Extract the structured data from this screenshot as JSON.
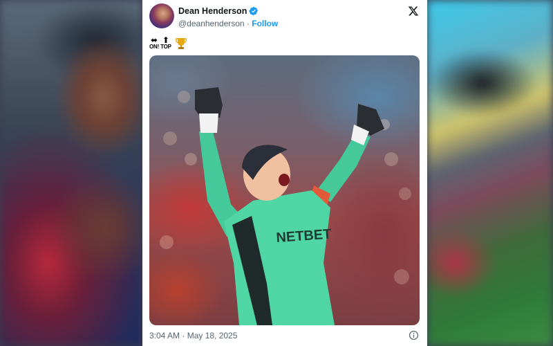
{
  "tweet": {
    "display_name": "Dean Henderson",
    "handle": "@deanhenderson",
    "separator": " · ",
    "follow_label": "Follow",
    "text": {
      "emoji_1_glyph": "⬌",
      "emoji_1_word": "ON!",
      "emoji_2_glyph": "⬆",
      "emoji_2_word": "TOP"
    },
    "timestamp": "3:04 AM · May 18, 2025",
    "photo_kit_text": "NETBET"
  },
  "icons": {
    "verified": "verified-badge-icon",
    "logo": "x-logo-icon",
    "trophy": "trophy-icon",
    "info": "info-icon"
  },
  "colors": {
    "accent": "#1d9bf0",
    "text_primary": "#0f1419",
    "text_secondary": "#536471",
    "kit_green": "#4fd6a4",
    "trophy_gold": "#e8a815"
  }
}
